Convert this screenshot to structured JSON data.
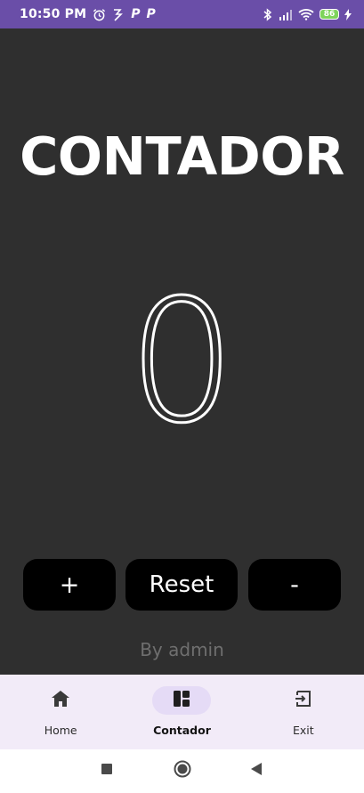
{
  "status_bar": {
    "time": "10:50 PM",
    "battery_level": "86",
    "left_icons": [
      "alarm-icon",
      "network-speed-icon",
      "p-app-icon",
      "p-app-icon"
    ],
    "right_icons": [
      "bluetooth-icon",
      "signal-icon",
      "wifi-icon",
      "battery-icon",
      "charging-icon"
    ]
  },
  "colors": {
    "status_bar_bg": "#6a4ea8",
    "main_bg": "#2f2f2f",
    "nav_bg": "#f2ebf8",
    "nav_active_pill": "#e5dbf6",
    "button_bg": "#000000"
  },
  "main": {
    "title": "CONTADOR",
    "counter_value": "0",
    "buttons": {
      "increment": "+",
      "reset": "Reset",
      "decrement": "-"
    },
    "byline": "By admin"
  },
  "bottom_nav": {
    "items": [
      {
        "label": "Home",
        "icon": "home-icon",
        "active": false
      },
      {
        "label": "Contador",
        "icon": "dashboard-icon",
        "active": true
      },
      {
        "label": "Exit",
        "icon": "exit-icon",
        "active": false
      }
    ]
  },
  "system_nav": [
    "recents-icon",
    "home-circle-icon",
    "back-icon"
  ]
}
